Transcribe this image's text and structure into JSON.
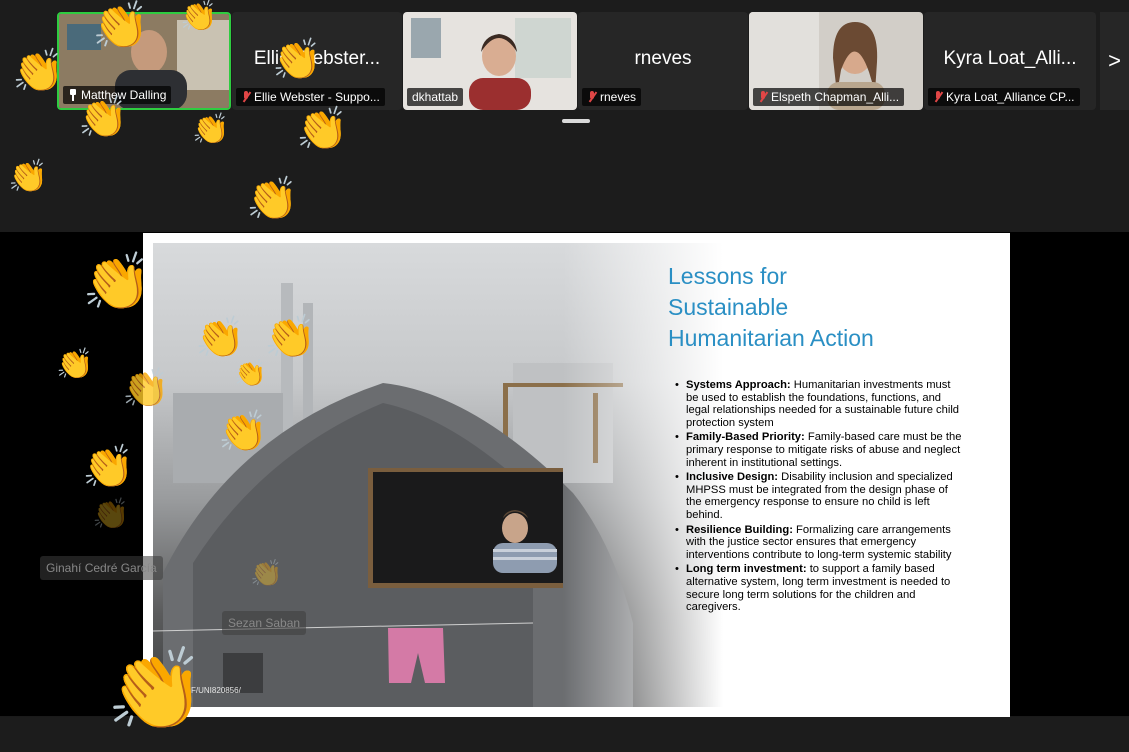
{
  "participants": [
    {
      "display": "",
      "label": "Matthew Dalling",
      "status_icon": "pin-icon",
      "video": true
    },
    {
      "display": "Ellie Webster...",
      "label": "Ellie Webster - Suppo...",
      "status_icon": "mic-muted-icon",
      "video": false
    },
    {
      "display": "",
      "label": "dkhattab",
      "status_icon": "",
      "video": true
    },
    {
      "display": "rneves",
      "label": "rneves",
      "status_icon": "mic-muted-icon",
      "video": false
    },
    {
      "display": "",
      "label": "Elspeth Chapman_Alli...",
      "status_icon": "mic-muted-icon",
      "video": true
    },
    {
      "display": "Kyra Loat_Alli...",
      "label": "Kyra Loat_Alliance CP...",
      "status_icon": "mic-muted-icon",
      "video": false
    }
  ],
  "nav": {
    "next_label": ">"
  },
  "slide": {
    "title_lines": [
      "Lessons for",
      "Sustainable",
      "Humanitarian Action"
    ],
    "bullets": [
      {
        "heading": "Systems Approach:",
        "text": " Humanitarian investments must be used to establish the foundations, functions, and legal relationships needed for a sustainable future child protection system"
      },
      {
        "heading": "Family-Based Priority:",
        "text": " Family-based care must be the primary response to mitigate risks of abuse and neglect inherent in institutional settings."
      },
      {
        "heading": "Inclusive Design:",
        "text": " Disability inclusion and specialized MHPSS must be integrated from the design phase of the emergency response to ensure no child is left behind."
      },
      {
        "heading": "Resilience Building:",
        "text": " Formalizing care arrangements with the justice sector ensures that emergency interventions contribute to long-term systemic stability"
      },
      {
        "heading": "Long term investment:",
        "text": " to support a family based alternative system, long term investment is needed to secure long term solutions for the children and caregivers."
      }
    ],
    "photo_credit": "F/UNI820856/"
  },
  "overlay_names": [
    "Ginahí Cedré García",
    "Sezan Saban"
  ],
  "reaction": {
    "emoji": "👏",
    "icon": "clapping-hands-icon"
  },
  "colors": {
    "accent": "#2a8fc4",
    "active_speaker": "#2ecc40",
    "muted": "#e04646"
  }
}
